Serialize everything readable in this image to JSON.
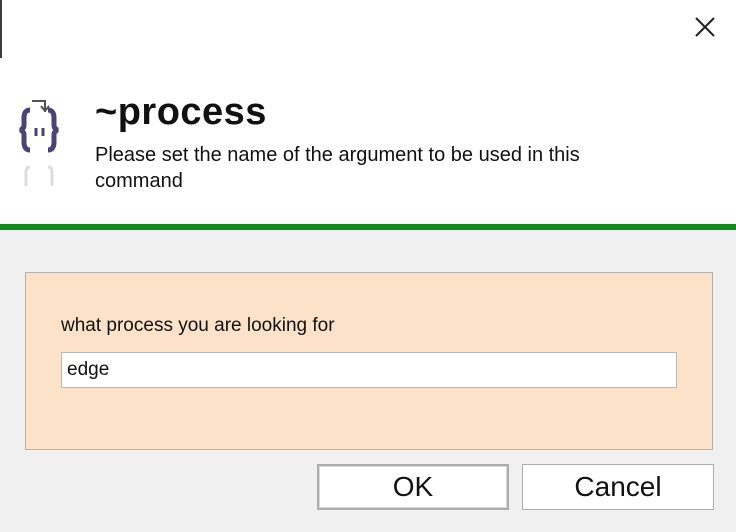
{
  "dialog": {
    "title": "~process",
    "subtitle": "Please set the name of the argument to be used in this command",
    "app_icon": "braces-download-icon",
    "close_icon": "close-icon",
    "accent_color": "#118a1e",
    "panel_color": "#fce2c8"
  },
  "form": {
    "prompt_label": "what process you are looking for",
    "input_value": "edge"
  },
  "buttons": {
    "ok_label": "OK",
    "cancel_label": "Cancel"
  }
}
